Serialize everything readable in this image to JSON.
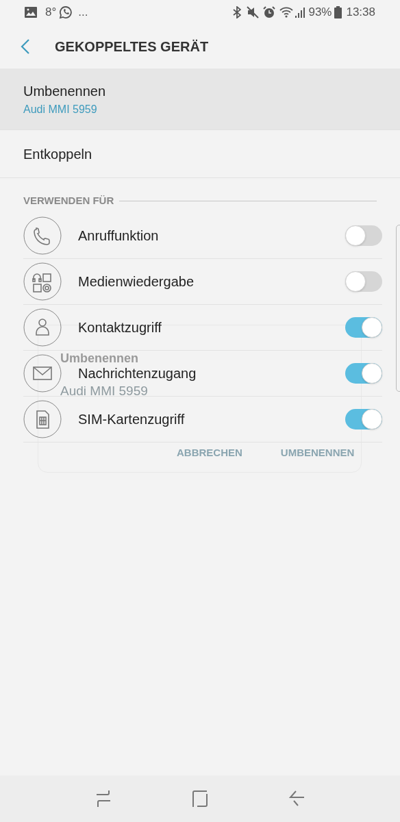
{
  "status_bar": {
    "temperature": "8°",
    "more": "...",
    "battery": "93%",
    "time": "13:38"
  },
  "header": {
    "title": "GEKOPPELTES GERÄT"
  },
  "actions": [
    {
      "label": "Umbenennen",
      "sublabel": "Audi MMI 5959",
      "selected": true
    },
    {
      "label": "Entkoppeln",
      "selected": false
    }
  ],
  "section": {
    "title": "VERWENDEN FÜR"
  },
  "profiles": [
    {
      "kind": "phone",
      "label": "Anruffunktion",
      "on": false
    },
    {
      "kind": "media",
      "label": "Medienwiedergabe",
      "on": false
    },
    {
      "kind": "contact",
      "label": "Kontaktzugriff",
      "on": true
    },
    {
      "kind": "message",
      "label": "Nachrichtenzugang",
      "on": true
    },
    {
      "kind": "sim",
      "label": "SIM-Kartenzugriff",
      "on": true
    }
  ],
  "dialog": {
    "title": "Umbenennen",
    "value": "Audi MMI 5959",
    "buttons": [
      "ABBRECHEN",
      "UMBENENNEN"
    ]
  }
}
